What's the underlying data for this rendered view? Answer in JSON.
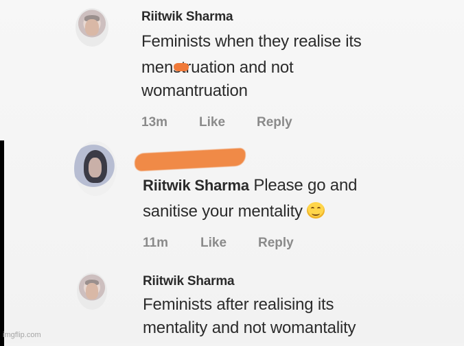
{
  "comments": [
    {
      "author": "Riitwik Sharma",
      "lines": [
        "Feminists when they realise its",
        "menstruation and not",
        "womantruation"
      ],
      "time": "13m",
      "like_label": "Like",
      "reply_label": "Reply"
    },
    {
      "mention": "Riitwik Sharma",
      "lines": [
        "Please go and",
        "sanitise your mentality"
      ],
      "emoji": "smiling-face-icon",
      "time": "11m",
      "like_label": "Like",
      "reply_label": "Reply"
    },
    {
      "author": "Riitwik Sharma",
      "lines": [
        "Feminists after realising its",
        "mentality and not womantality"
      ]
    }
  ],
  "watermark": "imgflip.com",
  "colors": {
    "background": "#f3f3f3",
    "text": "#2b2b2b",
    "meta": "#8a8a8a",
    "redaction": "#f08a47"
  }
}
